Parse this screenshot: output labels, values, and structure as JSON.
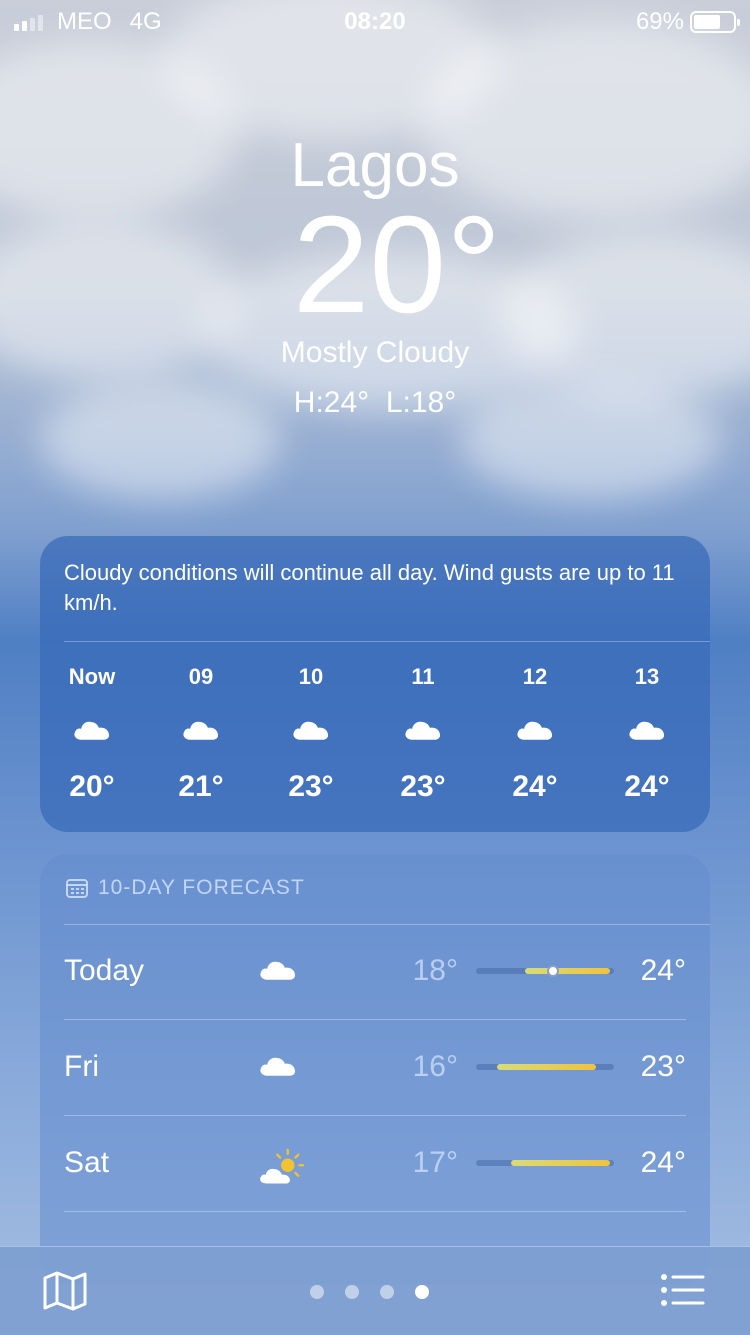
{
  "status_bar": {
    "carrier": "MEO",
    "network": "4G",
    "time": "08:20",
    "battery": "69%",
    "battery_level": 0.69
  },
  "location": {
    "city": "Lagos",
    "temperature": "20°",
    "condition": "Mostly Cloudy",
    "high_low": "H:24°  L:18°"
  },
  "hourly": {
    "summary": "Cloudy conditions will continue all day. Wind gusts are up to 11 km/h.",
    "items": [
      {
        "time": "Now",
        "icon": "cloud-icon",
        "temp": "20°"
      },
      {
        "time": "09",
        "icon": "cloud-icon",
        "temp": "21°"
      },
      {
        "time": "10",
        "icon": "cloud-icon",
        "temp": "23°"
      },
      {
        "time": "11",
        "icon": "cloud-icon",
        "temp": "23°"
      },
      {
        "time": "12",
        "icon": "cloud-icon",
        "temp": "24°"
      },
      {
        "time": "13",
        "icon": "cloud-icon",
        "temp": "24°"
      }
    ]
  },
  "daily": {
    "header": "10-DAY FORECAST",
    "header_icon": "calendar-icon",
    "items": [
      {
        "day": "Today",
        "icon": "cloud-icon",
        "low": "18°",
        "high": "24°",
        "low_value": 18,
        "high_value": 24,
        "current_value": 20
      },
      {
        "day": "Fri",
        "icon": "cloud-icon",
        "low": "16°",
        "high": "23°",
        "low_value": 16,
        "high_value": 23
      },
      {
        "day": "Sat",
        "icon": "partly-sunny-icon",
        "low": "17°",
        "high": "24°",
        "low_value": 17,
        "high_value": 24
      }
    ]
  },
  "bottom_bar": {
    "map_icon": "map-icon",
    "list_icon": "list-icon",
    "page_count": 4,
    "active_page": 4
  },
  "colors": {
    "range_start": "#d8dc78",
    "range_end": "#f0c23c"
  }
}
